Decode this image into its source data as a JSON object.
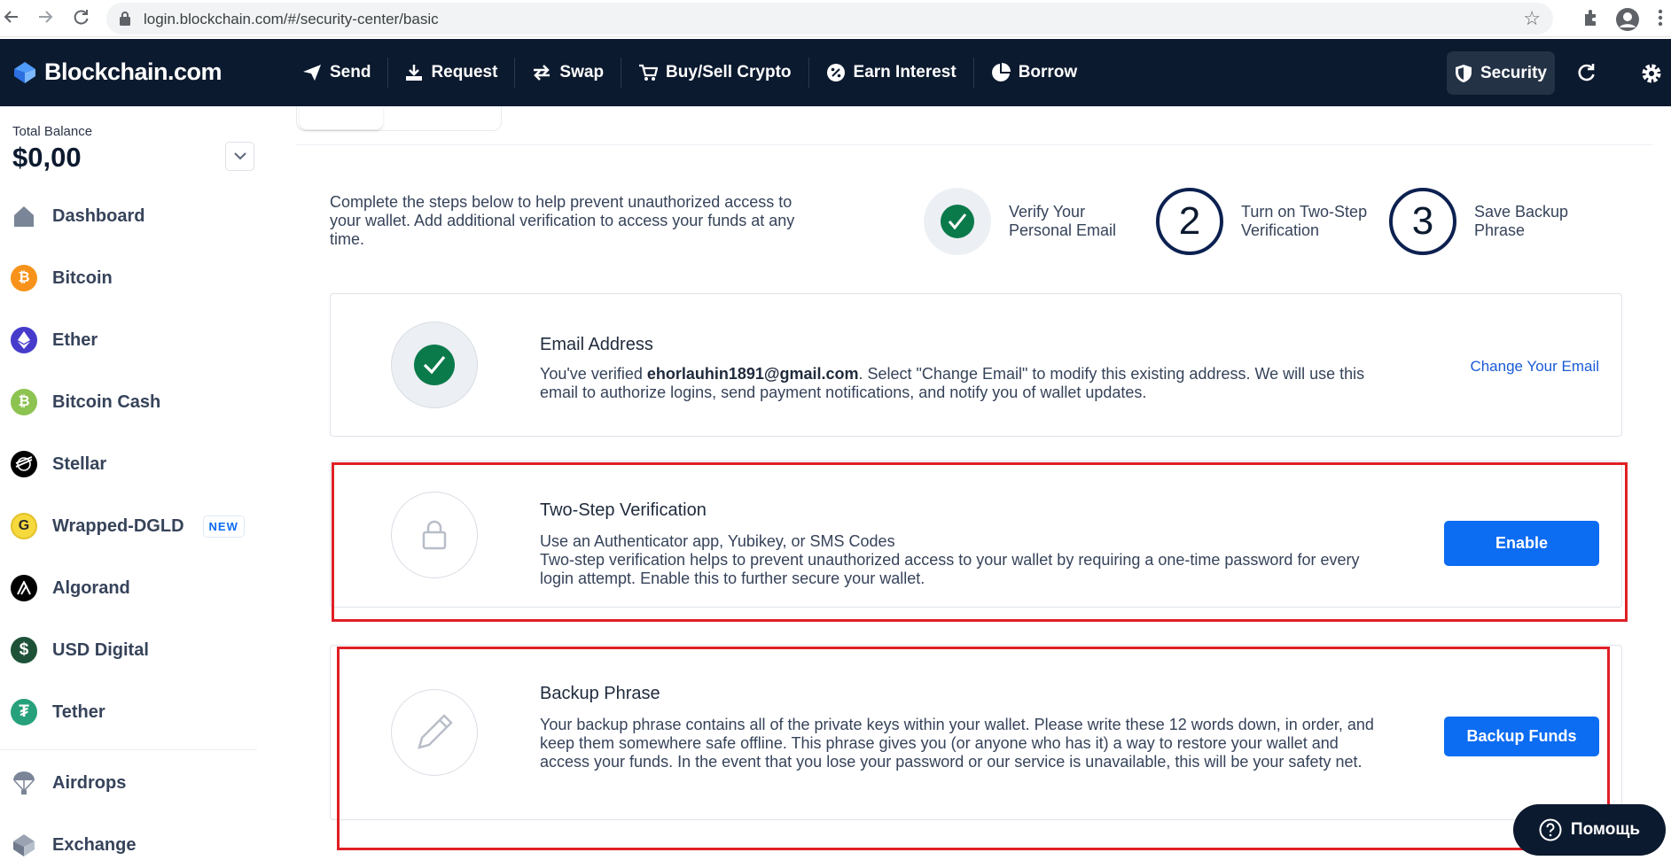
{
  "browser": {
    "url": "login.blockchain.com/#/security-center/basic"
  },
  "header": {
    "brand": "Blockchain.com",
    "nav": [
      {
        "label": "Send",
        "icon": "send-icon"
      },
      {
        "label": "Request",
        "icon": "request-icon"
      },
      {
        "label": "Swap",
        "icon": "swap-icon"
      },
      {
        "label": "Buy/Sell Crypto",
        "icon": "cart-icon"
      },
      {
        "label": "Earn Interest",
        "icon": "percent-icon"
      },
      {
        "label": "Borrow",
        "icon": "pie-icon"
      }
    ],
    "security_label": "Security"
  },
  "sidebar": {
    "balance_label": "Total Balance",
    "balance_value": "$0,00",
    "items": [
      {
        "label": "Dashboard",
        "icon": "home-icon"
      },
      {
        "label": "Bitcoin",
        "icon": "bitcoin-icon",
        "color": "#f7931a"
      },
      {
        "label": "Ether",
        "icon": "ether-icon",
        "color": "#473bcb"
      },
      {
        "label": "Bitcoin Cash",
        "icon": "bitcoin-cash-icon",
        "color": "#8dc351"
      },
      {
        "label": "Stellar",
        "icon": "stellar-icon",
        "color": "#000000"
      },
      {
        "label": "Wrapped-DGLD",
        "icon": "dgld-icon",
        "color": "#f6d93c",
        "badge": "NEW"
      },
      {
        "label": "Algorand",
        "icon": "algorand-icon",
        "color": "#000000"
      },
      {
        "label": "USD Digital",
        "icon": "usd-digital-icon",
        "color": "#1e5238"
      },
      {
        "label": "Tether",
        "icon": "tether-icon",
        "color": "#26a17b"
      },
      {
        "label": "Airdrops",
        "icon": "parachute-icon"
      },
      {
        "label": "Exchange",
        "icon": "exchange-icon"
      }
    ]
  },
  "main": {
    "intro": "Complete the steps below to help prevent unauthorized access to your wallet. Add additional verification to access your funds at any time.",
    "steps": [
      {
        "number": "",
        "label": "Verify Your Personal Email",
        "done": true
      },
      {
        "number": "2",
        "label": "Turn on Two-Step Verification",
        "done": false
      },
      {
        "number": "3",
        "label": "Save Backup Phrase",
        "done": false
      }
    ],
    "email_card": {
      "title": "Email Address",
      "desc_prefix": "You've verified ",
      "email": "ehorlauhin1891@gmail.com",
      "desc_suffix": ". Select \"Change Email\" to modify this existing address. We will use this email to authorize logins, send payment notifications, and notify you of wallet updates.",
      "link": "Change Your Email"
    },
    "two_step_card": {
      "title": "Two-Step Verification",
      "line1": "Use an Authenticator app, Yubikey, or SMS Codes",
      "line2": "Two-step verification helps to prevent unauthorized access to your wallet by requiring a one-time password for every login attempt. Enable this to further secure your wallet.",
      "button": "Enable"
    },
    "backup_card": {
      "title": "Backup Phrase",
      "desc": "Your backup phrase contains all of the private keys within your wallet. Please write these 12 words down, in order, and keep them somewhere safe offline. This phrase gives you (or anyone who has it) a way to restore your wallet and access your funds. In the event that you lose your password or our service is unavailable, this will be your safety net.",
      "button": "Backup Funds"
    }
  },
  "help": {
    "label": "Помощь"
  },
  "colors": {
    "header_bg": "#0c1a2f",
    "accent": "#0c6cf2",
    "success": "#0b7a4b",
    "highlight": "#e01f26"
  }
}
